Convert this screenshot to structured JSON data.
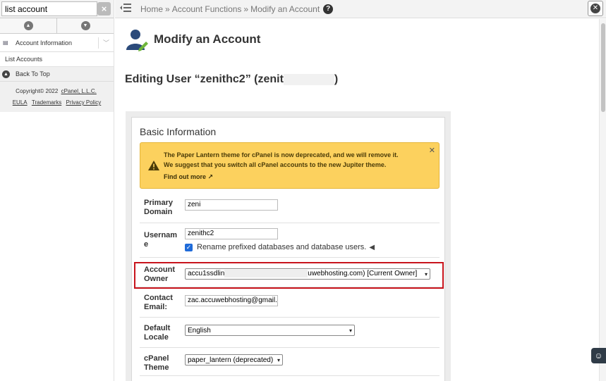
{
  "sidebar": {
    "search_value": "list account",
    "group_label": "Account Information",
    "item_label": "List Accounts",
    "back_to_top": "Back To Top",
    "copyright": "Copyright© 2022",
    "company_link": "cPanel, L.L.C.",
    "eula": "EULA",
    "trademarks": "Trademarks",
    "privacy": "Privacy Policy"
  },
  "breadcrumb": {
    "home": "Home",
    "functions": "Account Functions",
    "current": "Modify an Account",
    "sep": "»"
  },
  "page": {
    "title": "Modify an Account",
    "editing_prefix": "Editing User “zenithc2” (zenit",
    "editing_suffix": ")"
  },
  "card": {
    "heading": "Basic Information",
    "notice_line1": "The Paper Lantern theme for cPanel is now deprecated, and we will remove it.",
    "notice_line2": "We suggest that you switch all cPanel accounts to the new Jupiter theme.",
    "notice_link": "Find out more"
  },
  "fields": {
    "primary_domain_l1": "Primary",
    "primary_domain_l2": "Domain",
    "primary_domain_value": "zeni",
    "username_l1": "Usernam",
    "username_l2": "e",
    "username_value": "zenithc2",
    "rename_checkbox_label": "Rename prefixed databases and database users.",
    "owner_l1": "Account",
    "owner_l2": "Owner",
    "owner_value_start": "accu1ssdlin",
    "owner_value_end": "uwebhosting.com) [Current Owner]",
    "contact_l1": "Contact",
    "contact_l2": "Email:",
    "contact_value": "zac.accuwebhosting@gmail.",
    "locale_l1": "Default",
    "locale_l2": "Locale",
    "locale_value": "English",
    "theme_l1": "cPanel",
    "theme_l2": "Theme",
    "theme_value": "paper_lantern (deprecated)"
  },
  "colors": {
    "notice_bg": "#fcd15e",
    "highlight": "#c8141c",
    "checkbox": "#1f6bd9"
  }
}
